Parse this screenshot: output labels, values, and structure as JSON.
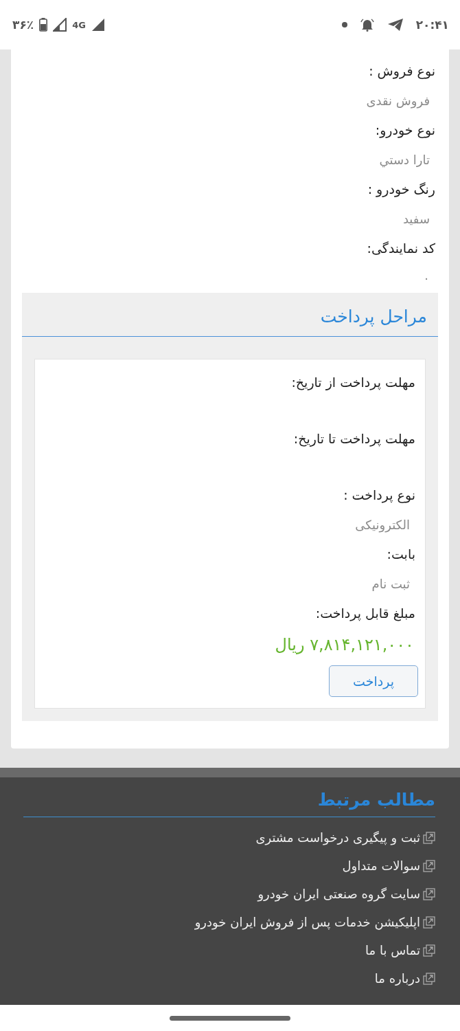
{
  "status_bar": {
    "time": "۲۰:۴۱",
    "battery": "۳۶٪",
    "network": "4G"
  },
  "details": [
    {
      "label": "نوع فروش :",
      "value": "فروش نقدی"
    },
    {
      "label": "نوع خودرو:",
      "value": "تارا دستي"
    },
    {
      "label": "رنگ خودرو :",
      "value": "سفید"
    },
    {
      "label": "کد نمایندگی:",
      "value": "۰"
    }
  ],
  "payment": {
    "title": "مراحل پرداخت",
    "fields": [
      {
        "kind": "blank",
        "label": "مهلت پرداخت از تاریخ:"
      },
      {
        "kind": "blank",
        "label": "مهلت پرداخت تا تاریخ:"
      },
      {
        "kind": "text",
        "label": "نوع پرداخت :",
        "value": "الکترونیکی"
      },
      {
        "kind": "text",
        "label": "بابت:",
        "value": "ثبت نام"
      },
      {
        "kind": "amount",
        "label": "مبلغ قابل پرداخت:",
        "value": "۷,۸۱۴,۱۲۱,۰۰۰ ریال"
      }
    ],
    "button": "پرداخت"
  },
  "footer": {
    "title": "مطالب مرتبط",
    "links": [
      "ثبت و پیگیری درخواست مشتری",
      "سوالات متداول",
      "سایت گروه صنعتی ایران خودرو",
      "اپلیکیشن خدمات پس از فروش ایران خودرو",
      "تماس با ما",
      "درباره ما"
    ]
  }
}
